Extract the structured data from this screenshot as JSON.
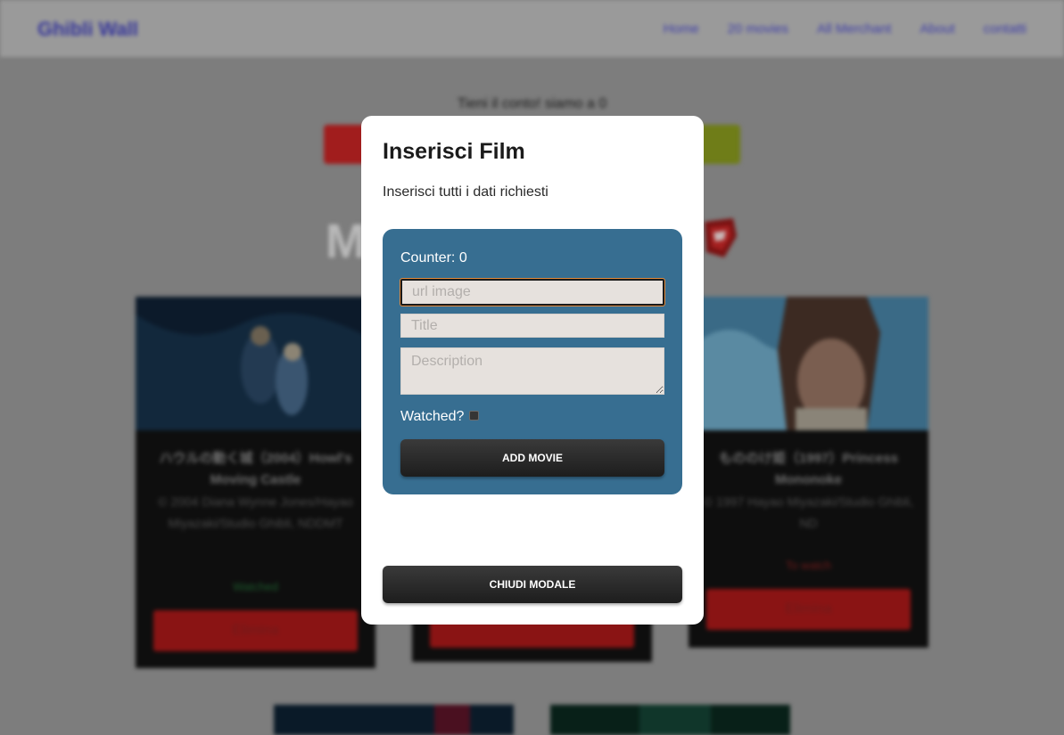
{
  "navbar": {
    "brand": "Ghibli Wall",
    "links": [
      "Home",
      "20 movies",
      "All Merchant",
      "About",
      "contatti"
    ]
  },
  "background": {
    "intro_text": "Tieni il conto! siamo a 0",
    "big_title": "M",
    "cards": [
      {
        "title": "ハウルの動く城（2004）Howl's Moving Castle",
        "meta": "© 2004 Diana Wynne Jones/Hayao Miyazaki/Studio Ghibli, NDDMT",
        "status": "Watched",
        "status_color": "#1c5a2c",
        "button": "Elimina"
      },
      {
        "title": "もののけ姫（1997）Princess Mononoke",
        "meta": "© 1997 Hayao Miyazaki/Studio Ghibli, ND",
        "status": "To watch",
        "status_color": "#6e1a1a",
        "button": "Elimina"
      }
    ]
  },
  "modal": {
    "title": "Inserisci Film",
    "subtitle": "Inserisci tutti i dati richiesti",
    "counter_label": "Counter: 0",
    "fields": {
      "url_placeholder": "url image",
      "title_placeholder": "Title",
      "description_placeholder": "Description"
    },
    "watched_label": "Watched?",
    "watched_checked": false,
    "add_button": "ADD MOVIE",
    "close_button": "CHIUDI MODALE"
  },
  "colors": {
    "form_panel": "#376e91",
    "field_bg": "#e6e1dd",
    "focus_ring": "#e0883a",
    "danger": "#d23030",
    "success": "#7a9b1e",
    "button_dark": "#222222"
  }
}
